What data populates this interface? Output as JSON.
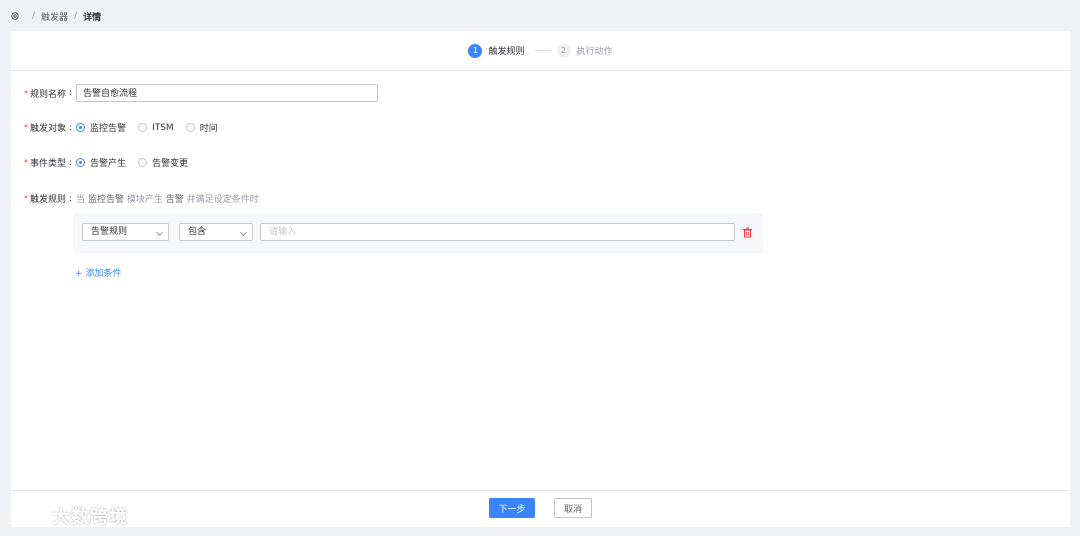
{
  "breadcrumb": {
    "items": [
      "触发器",
      "详情"
    ]
  },
  "steps": [
    {
      "num": "1",
      "label": "触发规则"
    },
    {
      "num": "2",
      "label": "执行动作"
    }
  ],
  "form": {
    "name": {
      "label": "规则名称",
      "value": "告警自愈流程"
    },
    "target": {
      "label": "触发对象",
      "options": [
        "监控告警",
        "ITSM",
        "时间"
      ],
      "selected": "监控告警"
    },
    "event": {
      "label": "事件类型",
      "options": [
        "告警产生",
        "告警变更"
      ],
      "selected": "告警产生"
    },
    "rule": {
      "label": "触发规则",
      "desc_prefix": "当",
      "desc_target": "监控告警",
      "desc_mid": "模块产生",
      "desc_event": "告警",
      "desc_suffix": "并满足设定条件时"
    }
  },
  "condition": {
    "field": "告警规则",
    "operator": "包含",
    "value_placeholder": "请输入"
  },
  "add_condition": "+ 添加条件",
  "footer": {
    "next": "下一步",
    "cancel": "取消"
  },
  "watermark": "大数跨境",
  "colors": {
    "primary": "#3a84ff",
    "required": "#ea3636",
    "delete": "#ea3636"
  }
}
